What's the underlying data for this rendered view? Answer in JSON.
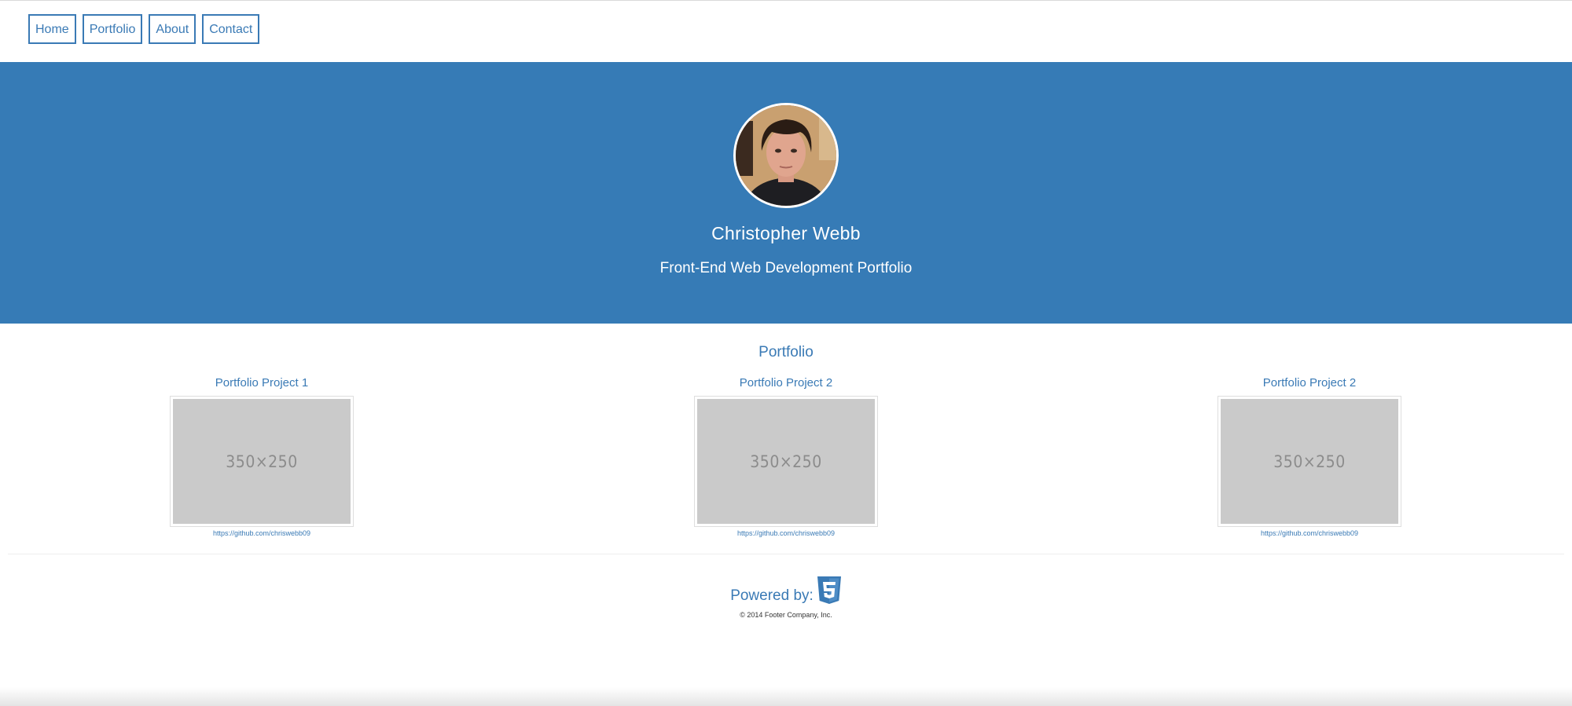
{
  "nav": {
    "items": [
      {
        "label": "Home"
      },
      {
        "label": "Portfolio"
      },
      {
        "label": "About"
      },
      {
        "label": "Contact"
      }
    ]
  },
  "hero": {
    "name": "Christopher Webb",
    "subtitle": "Front-End Web Development Portfolio",
    "avatar_colors": {
      "background": "#c9a070",
      "hair": "#2a1c14",
      "skin": "#e0a58e",
      "shirt": "#1e1e22"
    }
  },
  "portfolio": {
    "title": "Portfolio",
    "projects": [
      {
        "title": "Portfolio Project 1",
        "placeholder": "350×250",
        "link": "https://github.com/chriswebb09"
      },
      {
        "title": "Portfolio Project 2",
        "placeholder": "350×250",
        "link": "https://github.com/chriswebb09"
      },
      {
        "title": "Portfolio Project 2",
        "placeholder": "350×250",
        "link": "https://github.com/chriswebb09"
      }
    ]
  },
  "footer": {
    "powered_by": "Powered by:",
    "icon": "html5-icon",
    "copyright": "© 2014 Footer Company, Inc."
  },
  "colors": {
    "accent": "#3a7ab5",
    "hero_background": "#367bb6",
    "placeholder_fill": "#cacaca",
    "placeholder_text": "#8c8c8c"
  }
}
